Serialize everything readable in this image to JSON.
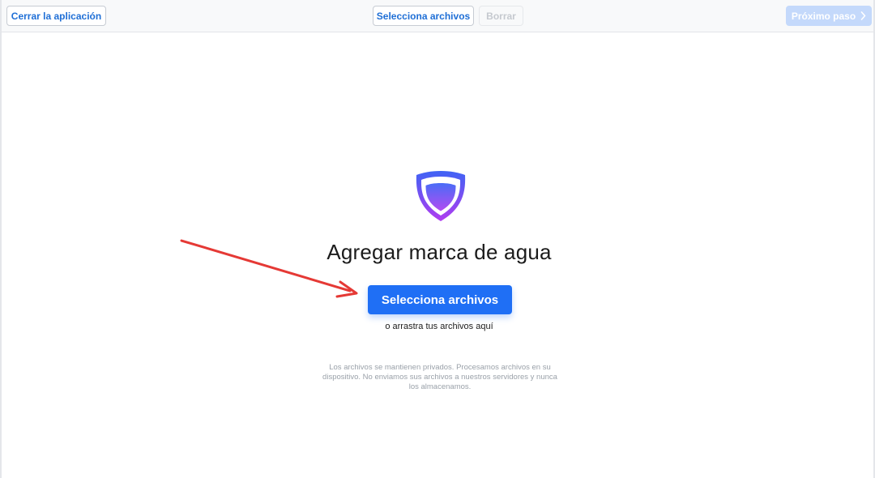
{
  "toolbar": {
    "close_label": "Cerrar la aplicación",
    "select_files_label": "Selecciona archivos",
    "delete_label": "Borrar",
    "next_label": "Próximo paso"
  },
  "main": {
    "title": "Agregar marca de agua",
    "select_files_label": "Selecciona archivos",
    "drag_hint": "o arrastra tus archivos aquí",
    "privacy_note": "Los archivos se mantienen privados. Procesamos archivos en su dispositivo. No enviamos sus archivos a nuestros servidores y nunca los almacenamos."
  },
  "icons": {
    "logo": "shield-icon",
    "next": "chevron-right-icon",
    "annotation": "red-arrow-icon"
  },
  "colors": {
    "primary": "#1f6ff5",
    "link_text": "#1f6fd6",
    "disabled_next": "#c4d9fb",
    "shield_top": "#3f63f4",
    "shield_bottom": "#b03cf0",
    "annotation_arrow": "#e53935"
  }
}
